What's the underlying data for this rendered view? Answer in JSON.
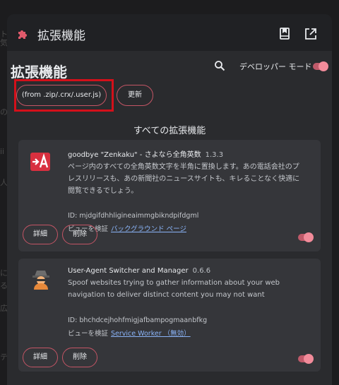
{
  "background_fragments": [
    "ト",
    "気",
    "の",
    "人",
    "ii",
    "に",
    "る",
    "広",
    "テ"
  ],
  "topbar": {
    "title": "拡張機能",
    "icon": "puzzle-icon",
    "actions": [
      "bookmark-manager-icon",
      "open-in-new-icon"
    ]
  },
  "page": {
    "title": "拡張機能",
    "developer_mode_label": "デベロッパー モード",
    "developer_mode_on": true,
    "load_button": "(from .zip/.crx/.user.js)",
    "update_button": "更新",
    "section_title": "すべての拡張機能"
  },
  "extensions": [
    {
      "name": "goodbye \"Zenkaku\" - さよなら全角英数",
      "version": "1.3.3",
      "description": "ページ内のすべての全角英数文字を半角に置換します。あの電話会社のプレスリリースも、あの新聞社のニュースサイトも、キレることなく快適に閲覧できるでしょう。",
      "id_line": "ID: mjdgifdhhligineaimmgbikndpifdgml",
      "inspect_label": "ビューを検証",
      "inspect_link": "バックグラウンド ページ",
      "details": "詳細",
      "remove": "削除",
      "enabled": true,
      "icon": "zenkaku-a-icon"
    },
    {
      "name": "User-Agent Switcher and Manager",
      "version": "0.6.6",
      "description": "Spoof websites trying to gather information about your web navigation to deliver distinct content you may not want",
      "id_line": "ID: bhchdcejhohfmigjafbampogmaanbfkg",
      "inspect_label": "ビューを検証",
      "inspect_link": "Service Worker （無効）",
      "details": "詳細",
      "remove": "削除",
      "enabled": true,
      "icon": "spy-agent-icon"
    }
  ],
  "colors": {
    "accent": "#c45565",
    "highlight_box": "#d4101a",
    "link": "#8ab4f8"
  }
}
